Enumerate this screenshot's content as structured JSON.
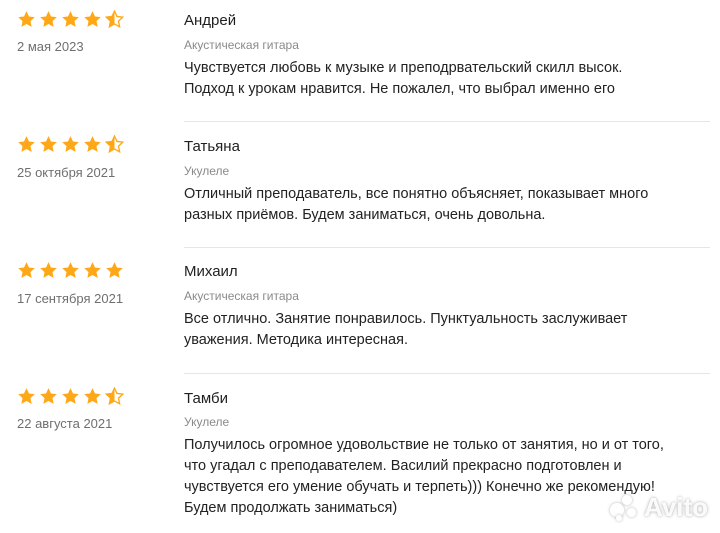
{
  "reviews": [
    {
      "author": "Андрей",
      "date": "2 мая 2023",
      "service": "Акустическая гитара",
      "rating": 4.5,
      "text_lines": [
        "Чувствуется любовь к музыке и преподрвательский скилл высок.",
        "Подход к урокам нравится. Не пожалел, что выбрал именно его"
      ]
    },
    {
      "author": "Татьяна",
      "date": "25 октября 2021",
      "service": "Укулеле",
      "rating": 4.5,
      "text_lines": [
        "Отличный преподаватель, все понятно объясняет, показывает много",
        "разных приёмов. Будем заниматься, очень довольна."
      ]
    },
    {
      "author": "Михаил",
      "date": "17 сентября 2021",
      "service": "Акустическая гитара",
      "rating": 5,
      "text_lines": [
        "Все отлично. Занятие понравилось. Пунктуальность заслуживает",
        "уважения. Методика интересная."
      ]
    },
    {
      "author": "Тамби",
      "date": "22 августа 2021",
      "service": "Укулеле",
      "rating": 4.5,
      "text_lines": [
        "Получилось огромное удовольствие не только от занятия, но и от того,",
        "что угадал с преподавателем. Василий прекрасно подготовлен и",
        "чувствуется его умение обучать и терпеть))) Конечно же рекомендую!",
        "Будем продолжать заниматься)"
      ]
    }
  ],
  "watermark": {
    "text": "Avito"
  },
  "colors": {
    "star": "#ffa817",
    "divider": "#e6e6e6"
  },
  "icons": {
    "star": "star-icon",
    "half_star": "star-half-icon"
  }
}
